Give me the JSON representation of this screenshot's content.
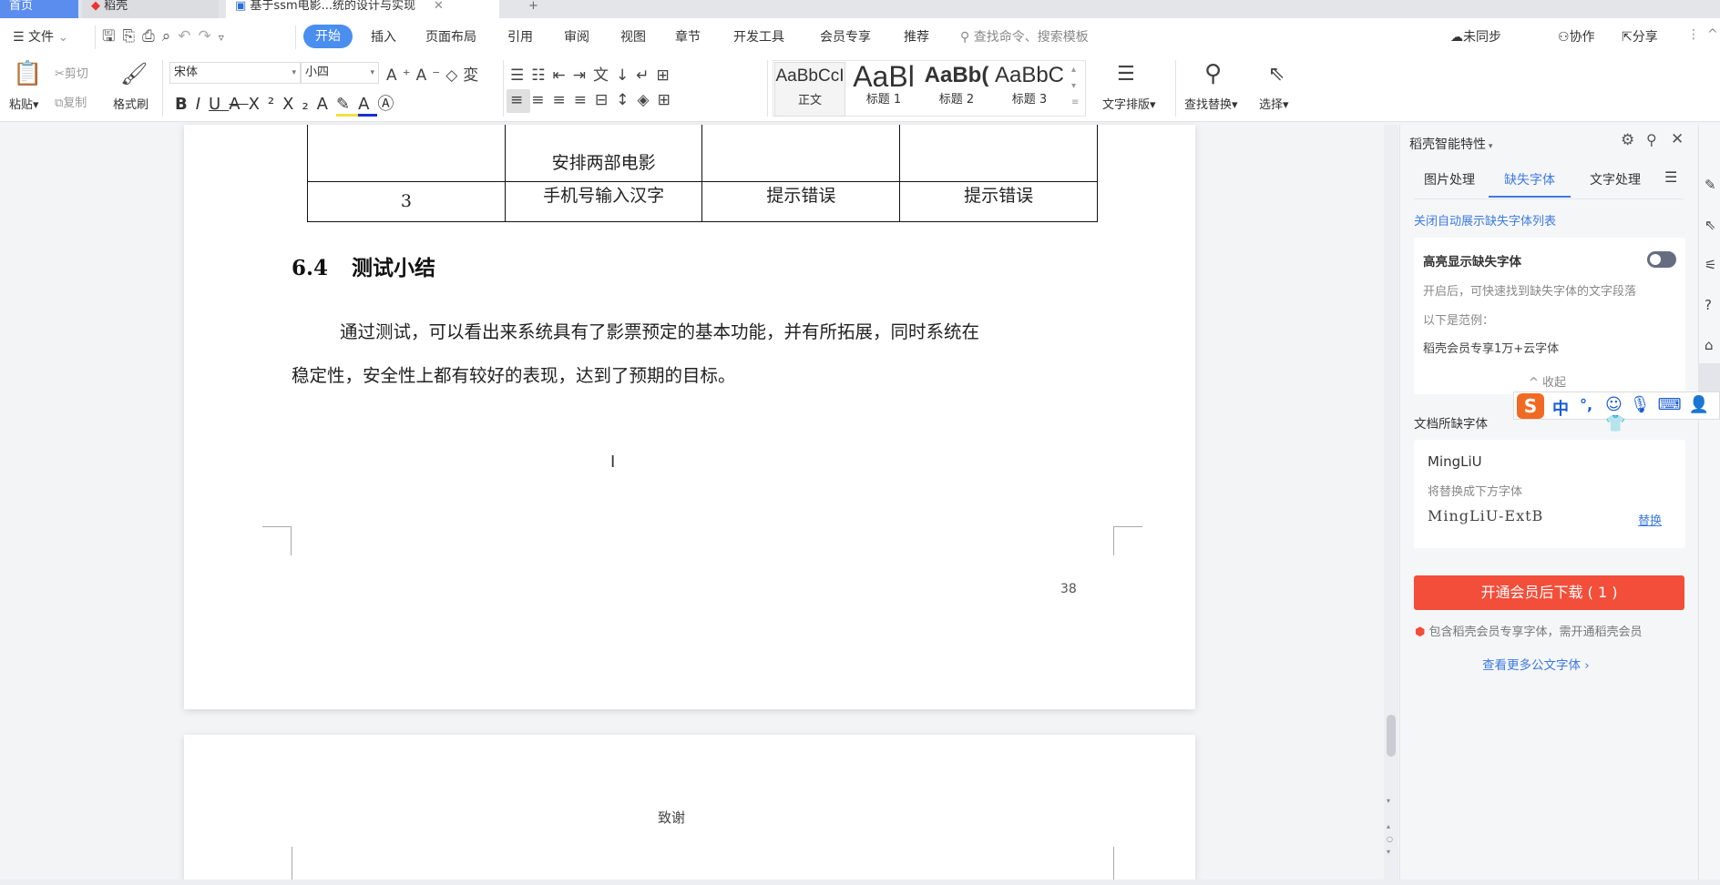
{
  "window_tabs": [
    {
      "label": "首页"
    },
    {
      "label": "稻壳"
    },
    {
      "label": "基于ssm电影...统的设计与实现"
    }
  ],
  "menu": {
    "file": "文件",
    "tabs": [
      "开始",
      "插入",
      "页面布局",
      "引用",
      "审阅",
      "视图",
      "章节",
      "开发工具",
      "会员专享",
      "推荐"
    ],
    "active_tab": "开始",
    "search_placeholder": "查找命令、搜索模板",
    "sync": "未同步",
    "collab": "协作",
    "share": "分享"
  },
  "ribbon": {
    "paste": "粘贴",
    "cut": "剪切",
    "copy": "复制",
    "format_painter": "格式刷",
    "font_name": "宋体",
    "font_size": "小四",
    "styles": [
      {
        "preview": "AaBbCcI",
        "label": "正文"
      },
      {
        "preview": "AaBl",
        "label": "标题 1"
      },
      {
        "preview": "AaBb(",
        "label": "标题 2"
      },
      {
        "preview": "AaBbC",
        "label": "标题 3"
      }
    ],
    "text_layout": "文字排版",
    "find_replace": "查找替换",
    "select": "选择"
  },
  "document": {
    "table_rows": [
      [
        "",
        "安排两部电影",
        "",
        ""
      ],
      [
        "3",
        "手机号输入汉字",
        "提示错误",
        "提示错误"
      ]
    ],
    "heading_num": "6.4",
    "heading": "测试小结",
    "para_line1": "通过测试，可以看出来系统具有了影票预定的基本功能，并有所拓展，同时系统在",
    "para_line2": "稳定性，安全性上都有较好的表现，达到了预期的目标。",
    "page_number": "38",
    "next_page_title": "致谢"
  },
  "panel": {
    "title": "稻壳智能特性",
    "tabs": [
      "图片处理",
      "缺失字体",
      "文字处理"
    ],
    "active_tab": "缺失字体",
    "close_auto_link": "关闭自动展示缺失字体列表",
    "highlight_title": "高亮显示缺失字体",
    "highlight_on": false,
    "highlight_desc": "开启后，可快速找到缺失字体的文字段落",
    "example_label": "以下是范例：",
    "example_text": "稻壳会员专享1万+云字体",
    "collapse": "收起",
    "missing_section": "文档所缺字体",
    "missing_font": "MingLiU",
    "replace_hint": "将替换成下方字体",
    "replacement_font": "MingLiU-ExtB",
    "replace_link": "替换",
    "download_button": "开通会员后下载 ( 1 )",
    "member_note": "包含稻壳会员专享字体，需开通稻壳会员",
    "more_fonts": "查看更多公文字体"
  },
  "ime": {
    "mode": "中",
    "punct": "°,"
  },
  "colors": {
    "accent": "#4a8ef0",
    "button": "#f24e3a",
    "link": "#3d7be0"
  }
}
